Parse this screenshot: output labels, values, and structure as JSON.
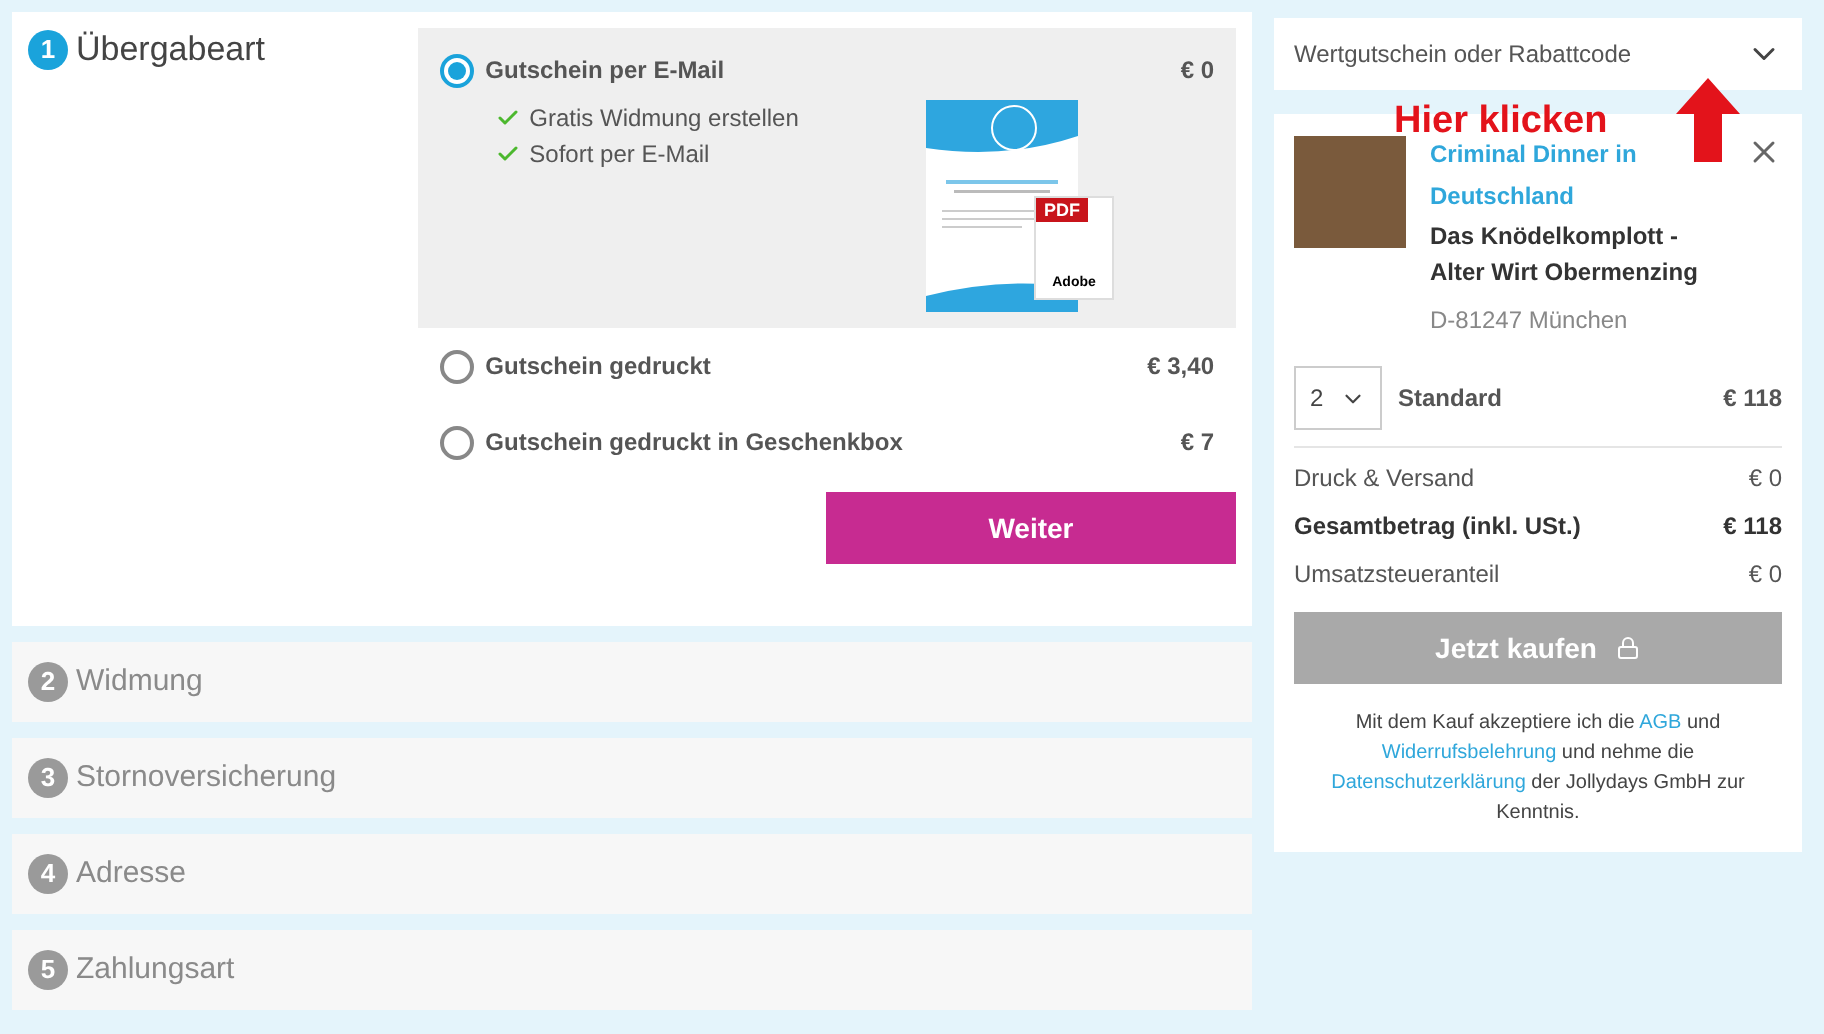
{
  "steps": [
    {
      "number": "1",
      "label": "Übergabeart",
      "active": true
    },
    {
      "number": "2",
      "label": "Widmung",
      "active": false
    },
    {
      "number": "3",
      "label": "Stornoversicherung",
      "active": false
    },
    {
      "number": "4",
      "label": "Adresse",
      "active": false
    },
    {
      "number": "5",
      "label": "Zahlungsart",
      "active": false
    }
  ],
  "delivery_options": [
    {
      "label": "Gutschein per E-Mail",
      "price": "€ 0",
      "selected": true,
      "features": [
        "Gratis Widmung erstellen",
        "Sofort per E-Mail"
      ],
      "badge": "PDF",
      "badge_caption": "Adobe"
    },
    {
      "label": "Gutschein gedruckt",
      "price": "€ 3,40",
      "selected": false
    },
    {
      "label": "Gutschein gedruckt in Geschenkbox",
      "price": "€ 7",
      "selected": false
    }
  ],
  "next_button": "Weiter",
  "coupon": {
    "label": "Wertgutschein oder Rabattcode",
    "expanded": false
  },
  "annotation": "Hier klicken",
  "cart_item": {
    "title": "Criminal Dinner in Deutschland",
    "subtitle": "Das Knödelkomplott - Alter Wirt Obermenzing",
    "location": "D-81247 München",
    "quantity": "2",
    "variant": "Standard",
    "price": "€ 118"
  },
  "totals": [
    {
      "label": "Druck & Versand",
      "value": "€ 0",
      "bold": false
    },
    {
      "label": "Gesamtbetrag (inkl. USt.)",
      "value": "€ 118",
      "bold": true
    },
    {
      "label": "Umsatzsteueranteil",
      "value": "€ 0",
      "bold": false
    }
  ],
  "buy_button": {
    "label": "Jetzt kaufen",
    "disabled": true
  },
  "legal": [
    {
      "kind": "text",
      "text": "Mit dem Kauf akzeptiere ich die "
    },
    {
      "kind": "link",
      "text": "AGB"
    },
    {
      "kind": "text",
      "text": " und "
    },
    {
      "kind": "link",
      "text": "Widerrufsbelehrung"
    },
    {
      "kind": "text",
      "text": " und nehme die "
    },
    {
      "kind": "link",
      "text": "Datenschutzerklärung"
    },
    {
      "kind": "text",
      "text": " der Jollydays GmbH zur Kenntnis."
    }
  ]
}
